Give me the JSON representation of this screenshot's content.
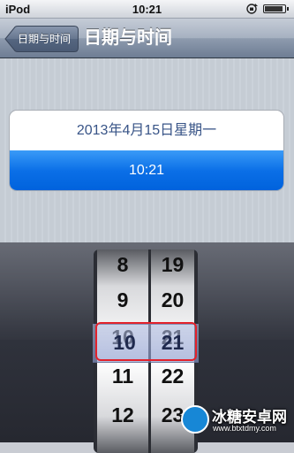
{
  "status_bar": {
    "carrier": "iPod",
    "time": "10:21",
    "battery_level": 0.9
  },
  "nav": {
    "back_label": "日期与时间",
    "title": "日期与时间"
  },
  "settings": {
    "date_text": "2013年4月15日星期一",
    "time_text": "10:21"
  },
  "picker": {
    "hours": [
      "8",
      "9",
      "10",
      "11",
      "12"
    ],
    "minutes": [
      "19",
      "20",
      "21",
      "22",
      "23"
    ],
    "selected_hour": "10",
    "selected_minute": "21"
  },
  "watermark": {
    "title": "冰糖安卓网",
    "url": "www.btxtdmy.com"
  },
  "colors": {
    "accent": "#0b6fe7",
    "highlight": "#e3212b"
  }
}
